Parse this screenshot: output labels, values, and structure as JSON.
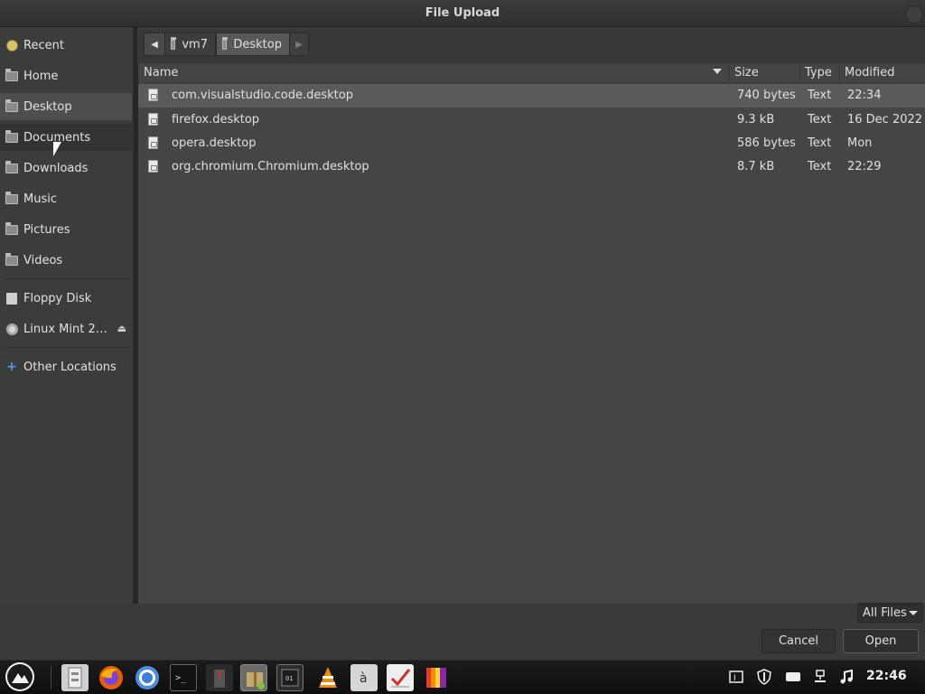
{
  "window": {
    "title": "File Upload"
  },
  "sidebar": {
    "items": [
      {
        "label": "Recent",
        "icon": "recent-icon"
      },
      {
        "label": "Home",
        "icon": "home-folder-icon"
      },
      {
        "label": "Desktop",
        "icon": "desktop-folder-icon",
        "selected": true
      },
      {
        "label": "Documents",
        "icon": "documents-folder-icon",
        "hover": true
      },
      {
        "label": "Downloads",
        "icon": "downloads-folder-icon"
      },
      {
        "label": "Music",
        "icon": "music-folder-icon"
      },
      {
        "label": "Pictures",
        "icon": "pictures-folder-icon"
      },
      {
        "label": "Videos",
        "icon": "videos-folder-icon"
      }
    ],
    "devices": [
      {
        "label": "Floppy Disk",
        "icon": "floppy-disk-icon"
      },
      {
        "label": "Linux Mint 2…",
        "icon": "optical-disc-icon",
        "eject": "⏏"
      }
    ],
    "other": {
      "label": "Other Locations",
      "icon": "other-locations-icon",
      "glyph": "+"
    }
  },
  "pathbar": {
    "back_glyph": "◀",
    "forward_glyph": "▶",
    "crumbs": [
      {
        "label": "vm7"
      },
      {
        "label": "Desktop",
        "active": true
      }
    ]
  },
  "filelist": {
    "columns": {
      "name": "Name",
      "size": "Size",
      "type": "Type",
      "modified": "Modified"
    },
    "sort": {
      "column": "Name",
      "direction": "descending"
    },
    "rows": [
      {
        "name": "com.visualstudio.code.desktop",
        "size": "740 bytes",
        "type": "Text",
        "modified": "22:34",
        "selected": true
      },
      {
        "name": "firefox.desktop",
        "size": "9.3 kB",
        "type": "Text",
        "modified": "16 Dec 2022"
      },
      {
        "name": "opera.desktop",
        "size": "586 bytes",
        "type": "Text",
        "modified": "Mon"
      },
      {
        "name": "org.chromium.Chromium.desktop",
        "size": "8.7 kB",
        "type": "Text",
        "modified": "22:29"
      }
    ]
  },
  "footer": {
    "filter": "All Files",
    "cancel_label": "Cancel",
    "open_label": "Open"
  },
  "taskbar": {
    "apps": [
      "menu-icon",
      "file-manager-icon",
      "firefox-icon",
      "chromium-icon",
      "terminal-icon",
      "user-icon",
      "archive-manager-icon",
      "system-monitor-icon",
      "vlc-icon",
      "character-map-icon",
      "tasks-icon",
      "color-palette-icon"
    ],
    "tray": [
      "keyboard-layout-icon",
      "shield-icon",
      "display-icon",
      "network-icon",
      "sound-icon"
    ],
    "clock": "22:46"
  },
  "colors": {
    "accent_blue": "#4f9fe8",
    "firefox_orange": "#e66000",
    "vlc_orange": "#f08a00",
    "selection": "#5a5a5a"
  }
}
